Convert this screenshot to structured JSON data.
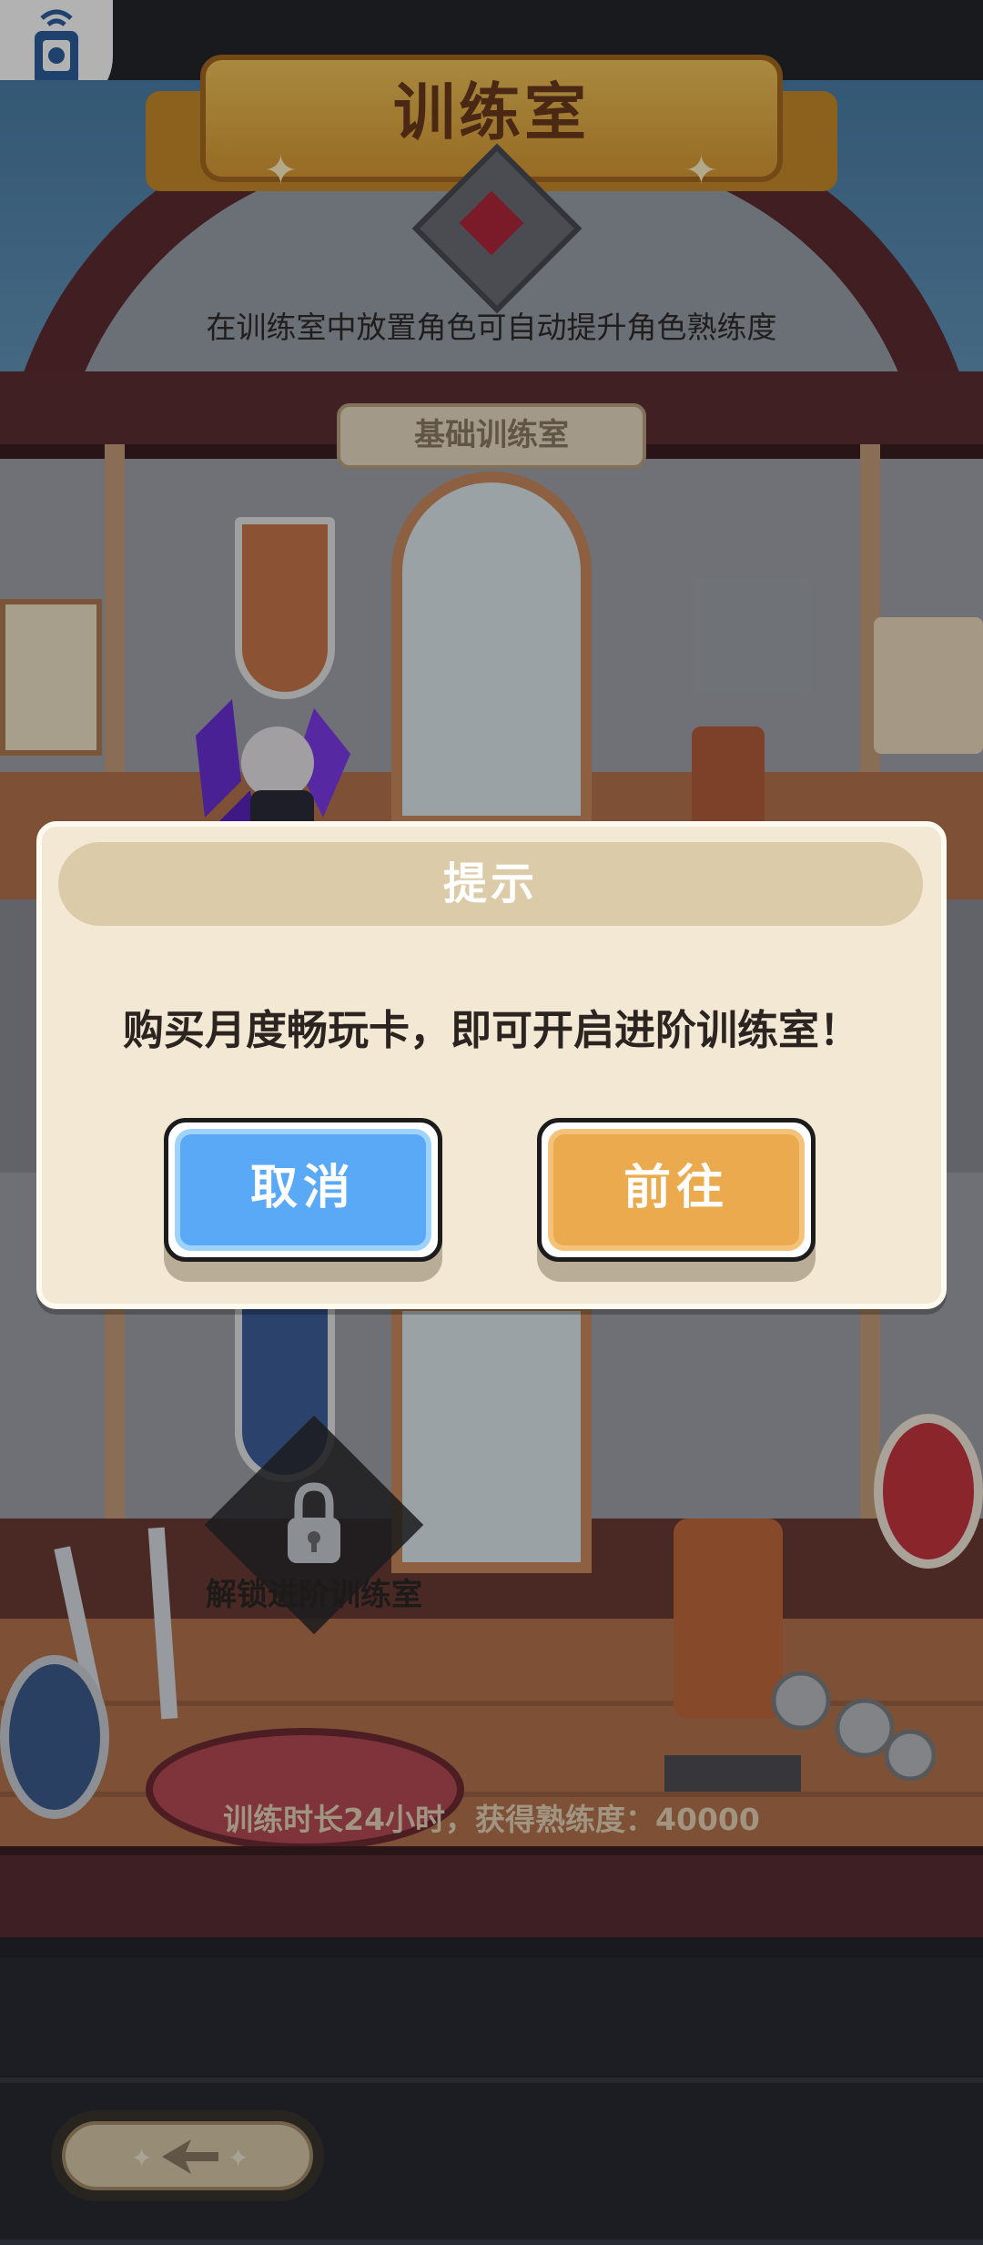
{
  "room": {
    "title": "训练室",
    "subtitle": "在训练室中放置角色可自动提升角色熟练度",
    "basic_section": "基础训练室",
    "unlock_label": "解锁进阶训练室",
    "footnote": "训练时长24小时，获得熟练度：40000"
  },
  "dialog": {
    "title": "提示",
    "message": "购买月度畅玩卡，即可开启进阶训练室！",
    "cancel_label": "取消",
    "go_label": "前往"
  },
  "icons": {
    "app_icon": "accessibility-app-icon",
    "lock": "lock-icon",
    "back": "back-arrow-icon"
  },
  "colors": {
    "cancel_button": "#5aa9f6",
    "go_button": "#ecaa4f",
    "dialog_background": "#f2e8d4",
    "title_ribbon": "#e3ac45"
  }
}
